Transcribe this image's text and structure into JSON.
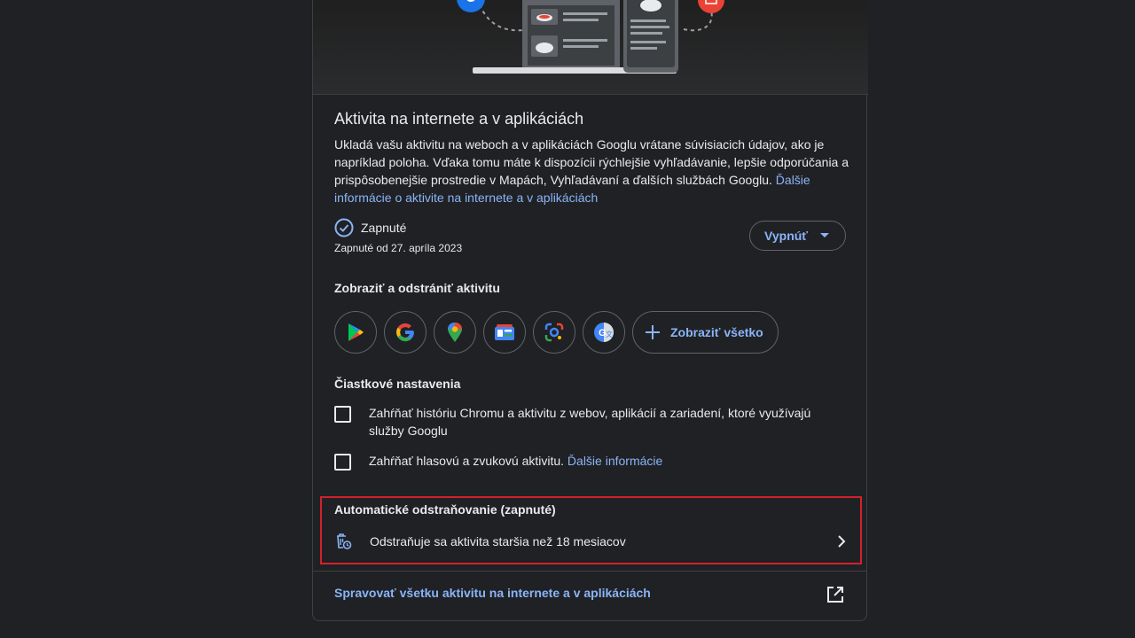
{
  "header": {
    "title": "Aktivita na internete a v aplikáciách"
  },
  "description": {
    "text": "Ukladá vašu aktivitu na weboch a v aplikáciách Googlu vrátane súvisiacich údajov, ako je napríklad poloha. Vďaka tomu máte k dispozícii rýchlejšie vyhľadávanie, lepšie odporúčania a prispôsobenejšie prostredie v Mapách, Vyhľadávaní a ďalších službách Googlu.",
    "link": "Ďalšie informácie o aktivite na internete a v aplikáciách"
  },
  "status": {
    "label": "Zapnuté",
    "since": "Zapnuté od 27. apríla 2023",
    "toggle_label": "Vypnúť"
  },
  "activity": {
    "title": "Zobraziť a odstrániť aktivitu",
    "apps": [
      {
        "name": "play-store-icon"
      },
      {
        "name": "google-icon"
      },
      {
        "name": "maps-icon"
      },
      {
        "name": "news-icon"
      },
      {
        "name": "lens-icon"
      },
      {
        "name": "translate-icon"
      }
    ],
    "view_all": "Zobraziť všetko"
  },
  "sub_settings": {
    "title": "Čiastkové nastavenia",
    "chrome_history": "Zahŕňať históriu Chromu a aktivitu z webov, aplikácií a zariadení, ktoré využívajú služby Googlu",
    "audio_activity": "Zahŕňať hlasovú a zvukovú aktivitu.",
    "audio_link": "Ďalšie informácie"
  },
  "auto_delete": {
    "title": "Automatické odstraňovanie (zapnuté)",
    "description": "Odstraňuje sa aktivita staršia než 18 mesiacov"
  },
  "footer": {
    "manage_link": "Spravovať všetku aktivitu na internete a v aplikáciách"
  },
  "colors": {
    "accent": "#8ab4f8",
    "highlight": "#d2222d",
    "background": "#202124"
  }
}
